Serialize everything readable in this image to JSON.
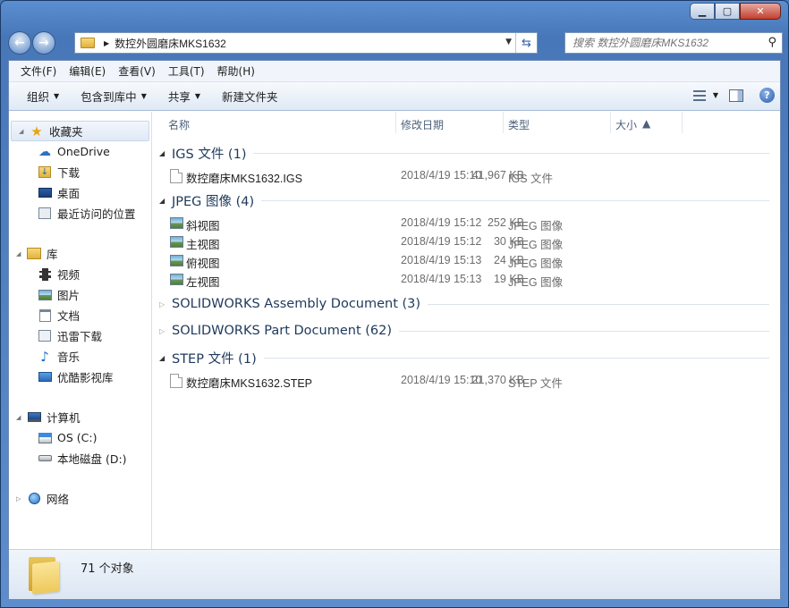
{
  "window": {
    "minimize_icon": "minimize-icon",
    "maximize_icon": "maximize-icon",
    "close_icon": "close-icon"
  },
  "address": {
    "path": "数控外圆磨床MKS1632"
  },
  "search": {
    "placeholder": "搜索 数控外圆磨床MKS1632"
  },
  "menu": [
    "文件(F)",
    "编辑(E)",
    "查看(V)",
    "工具(T)",
    "帮助(H)"
  ],
  "toolbar": {
    "organize": "组织",
    "include_library": "包含到库中",
    "share": "共享",
    "new_folder": "新建文件夹"
  },
  "nav": {
    "favorites": "收藏夹",
    "fav_items": [
      "OneDrive",
      "下载",
      "桌面",
      "最近访问的位置"
    ],
    "libraries": "库",
    "lib_items": [
      "视频",
      "图片",
      "文档",
      "迅雷下载",
      "音乐",
      "优酷影视库"
    ],
    "computer": "计算机",
    "drives": [
      "OS (C:)",
      "本地磁盘 (D:)"
    ],
    "network": "网络"
  },
  "columns": {
    "name": "名称",
    "date": "修改日期",
    "type": "类型",
    "size": "大小"
  },
  "groups": {
    "igs": {
      "title": "IGS 文件 (1)",
      "files": [
        {
          "name": "数控磨床MKS1632.IGS",
          "date": "2018/4/19 15:10",
          "type": "IGS 文件",
          "size": "41,967 KB"
        }
      ]
    },
    "jpeg": {
      "title": "JPEG 图像 (4)",
      "files": [
        {
          "name": "斜视图",
          "date": "2018/4/19 15:12",
          "type": "JPEG 图像",
          "size": "252 KB"
        },
        {
          "name": "主视图",
          "date": "2018/4/19 15:12",
          "type": "JPEG 图像",
          "size": "30 KB"
        },
        {
          "name": "俯视图",
          "date": "2018/4/19 15:13",
          "type": "JPEG 图像",
          "size": "24 KB"
        },
        {
          "name": "左视图",
          "date": "2018/4/19 15:13",
          "type": "JPEG 图像",
          "size": "19 KB"
        }
      ]
    },
    "asm": {
      "title": "SOLIDWORKS Assembly Document (3)"
    },
    "part": {
      "title": "SOLIDWORKS Part Document (62)"
    },
    "step": {
      "title": "STEP 文件 (1)",
      "files": [
        {
          "name": "数控磨床MKS1632.STEP",
          "date": "2018/4/19 15:10",
          "type": "STEP 文件",
          "size": "21,370 KB"
        }
      ]
    }
  },
  "status": {
    "count": "71 个对象"
  }
}
